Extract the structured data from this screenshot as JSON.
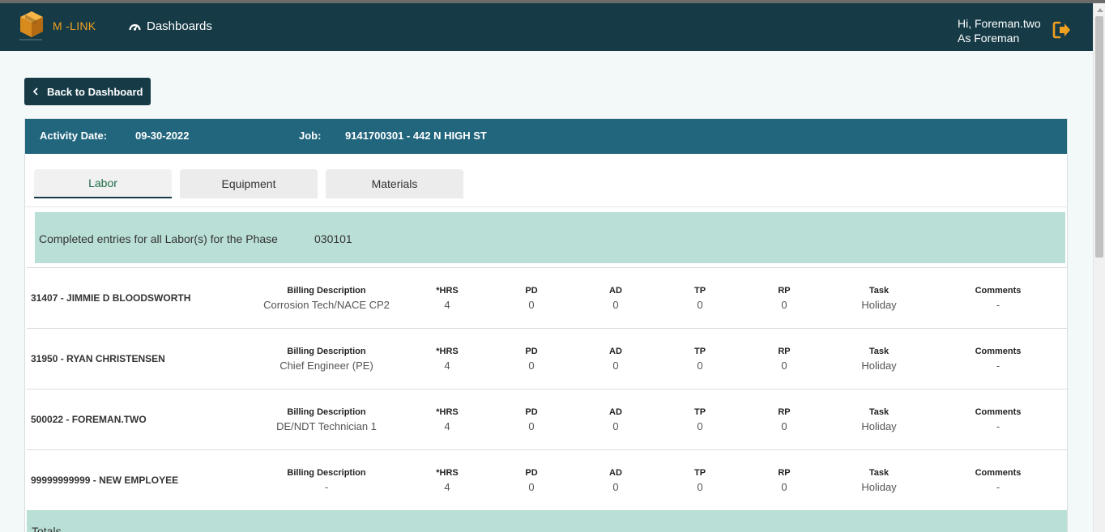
{
  "navbar": {
    "brand": "M -LINK",
    "nav_label": "Dashboards",
    "greeting": "Hi, Foreman.two",
    "role": "As Foreman",
    "colors": {
      "bar": "#163b47",
      "accent": "#f0a020"
    }
  },
  "back_button": {
    "label": "Back to Dashboard"
  },
  "header": {
    "activity_label": "Activity Date:",
    "activity_date": "09-30-2022",
    "job_label": "Job:",
    "job_value": "9141700301 - 442 N HIGH ST"
  },
  "tabs": [
    {
      "label": "Labor",
      "active": true
    },
    {
      "label": "Equipment",
      "active": false
    },
    {
      "label": "Materials",
      "active": false
    }
  ],
  "phase": {
    "text": "Completed entries for all Labor(s) for the Phase",
    "code": "030101"
  },
  "columns": {
    "billing": "Billing Description",
    "hrs": "*HRS",
    "pd": "PD",
    "ad": "AD",
    "tp": "TP",
    "rp": "RP",
    "task": "Task",
    "comments": "Comments"
  },
  "rows": [
    {
      "name": "31407 - JIMMIE D BLOODSWORTH",
      "billing": "Corrosion Tech/NACE CP2",
      "hrs": "4",
      "pd": "0",
      "ad": "0",
      "tp": "0",
      "rp": "0",
      "task": "Holiday",
      "comments": "-"
    },
    {
      "name": "31950 - RYAN CHRISTENSEN",
      "billing": "Chief Engineer (PE)",
      "hrs": "4",
      "pd": "0",
      "ad": "0",
      "tp": "0",
      "rp": "0",
      "task": "Holiday",
      "comments": "-"
    },
    {
      "name": "500022 - FOREMAN.TWO",
      "billing": "DE/NDT Technician 1",
      "hrs": "4",
      "pd": "0",
      "ad": "0",
      "tp": "0",
      "rp": "0",
      "task": "Holiday",
      "comments": "-"
    },
    {
      "name": "99999999999 - NEW EMPLOYEE",
      "billing": "-",
      "hrs": "4",
      "pd": "0",
      "ad": "0",
      "tp": "0",
      "rp": "0",
      "task": "Holiday",
      "comments": "-"
    }
  ],
  "totals": {
    "label": "Totals"
  }
}
